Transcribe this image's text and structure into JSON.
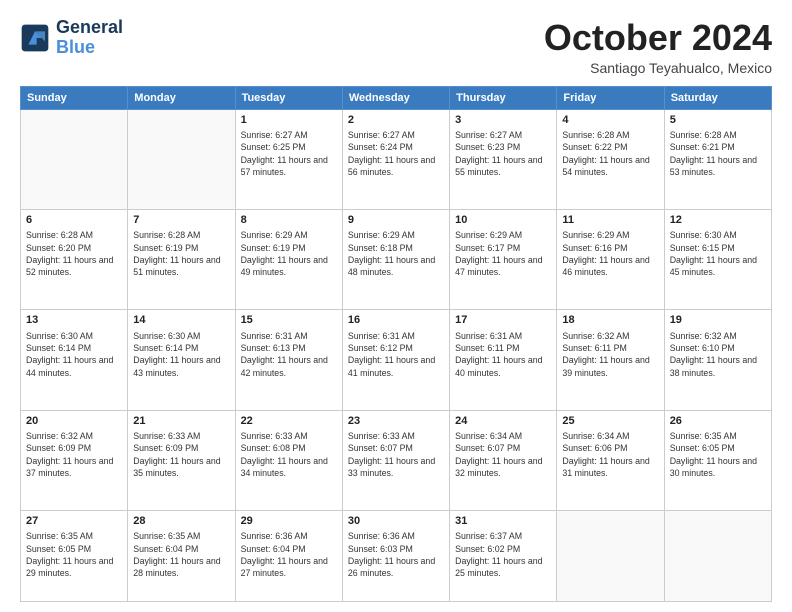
{
  "header": {
    "logo_line1": "General",
    "logo_line2": "Blue",
    "month_title": "October 2024",
    "subtitle": "Santiago Teyahualco, Mexico"
  },
  "days_of_week": [
    "Sunday",
    "Monday",
    "Tuesday",
    "Wednesday",
    "Thursday",
    "Friday",
    "Saturday"
  ],
  "weeks": [
    [
      {
        "day": "",
        "info": ""
      },
      {
        "day": "",
        "info": ""
      },
      {
        "day": "1",
        "info": "Sunrise: 6:27 AM\nSunset: 6:25 PM\nDaylight: 11 hours and 57 minutes."
      },
      {
        "day": "2",
        "info": "Sunrise: 6:27 AM\nSunset: 6:24 PM\nDaylight: 11 hours and 56 minutes."
      },
      {
        "day": "3",
        "info": "Sunrise: 6:27 AM\nSunset: 6:23 PM\nDaylight: 11 hours and 55 minutes."
      },
      {
        "day": "4",
        "info": "Sunrise: 6:28 AM\nSunset: 6:22 PM\nDaylight: 11 hours and 54 minutes."
      },
      {
        "day": "5",
        "info": "Sunrise: 6:28 AM\nSunset: 6:21 PM\nDaylight: 11 hours and 53 minutes."
      }
    ],
    [
      {
        "day": "6",
        "info": "Sunrise: 6:28 AM\nSunset: 6:20 PM\nDaylight: 11 hours and 52 minutes."
      },
      {
        "day": "7",
        "info": "Sunrise: 6:28 AM\nSunset: 6:19 PM\nDaylight: 11 hours and 51 minutes."
      },
      {
        "day": "8",
        "info": "Sunrise: 6:29 AM\nSunset: 6:19 PM\nDaylight: 11 hours and 49 minutes."
      },
      {
        "day": "9",
        "info": "Sunrise: 6:29 AM\nSunset: 6:18 PM\nDaylight: 11 hours and 48 minutes."
      },
      {
        "day": "10",
        "info": "Sunrise: 6:29 AM\nSunset: 6:17 PM\nDaylight: 11 hours and 47 minutes."
      },
      {
        "day": "11",
        "info": "Sunrise: 6:29 AM\nSunset: 6:16 PM\nDaylight: 11 hours and 46 minutes."
      },
      {
        "day": "12",
        "info": "Sunrise: 6:30 AM\nSunset: 6:15 PM\nDaylight: 11 hours and 45 minutes."
      }
    ],
    [
      {
        "day": "13",
        "info": "Sunrise: 6:30 AM\nSunset: 6:14 PM\nDaylight: 11 hours and 44 minutes."
      },
      {
        "day": "14",
        "info": "Sunrise: 6:30 AM\nSunset: 6:14 PM\nDaylight: 11 hours and 43 minutes."
      },
      {
        "day": "15",
        "info": "Sunrise: 6:31 AM\nSunset: 6:13 PM\nDaylight: 11 hours and 42 minutes."
      },
      {
        "day": "16",
        "info": "Sunrise: 6:31 AM\nSunset: 6:12 PM\nDaylight: 11 hours and 41 minutes."
      },
      {
        "day": "17",
        "info": "Sunrise: 6:31 AM\nSunset: 6:11 PM\nDaylight: 11 hours and 40 minutes."
      },
      {
        "day": "18",
        "info": "Sunrise: 6:32 AM\nSunset: 6:11 PM\nDaylight: 11 hours and 39 minutes."
      },
      {
        "day": "19",
        "info": "Sunrise: 6:32 AM\nSunset: 6:10 PM\nDaylight: 11 hours and 38 minutes."
      }
    ],
    [
      {
        "day": "20",
        "info": "Sunrise: 6:32 AM\nSunset: 6:09 PM\nDaylight: 11 hours and 37 minutes."
      },
      {
        "day": "21",
        "info": "Sunrise: 6:33 AM\nSunset: 6:09 PM\nDaylight: 11 hours and 35 minutes."
      },
      {
        "day": "22",
        "info": "Sunrise: 6:33 AM\nSunset: 6:08 PM\nDaylight: 11 hours and 34 minutes."
      },
      {
        "day": "23",
        "info": "Sunrise: 6:33 AM\nSunset: 6:07 PM\nDaylight: 11 hours and 33 minutes."
      },
      {
        "day": "24",
        "info": "Sunrise: 6:34 AM\nSunset: 6:07 PM\nDaylight: 11 hours and 32 minutes."
      },
      {
        "day": "25",
        "info": "Sunrise: 6:34 AM\nSunset: 6:06 PM\nDaylight: 11 hours and 31 minutes."
      },
      {
        "day": "26",
        "info": "Sunrise: 6:35 AM\nSunset: 6:05 PM\nDaylight: 11 hours and 30 minutes."
      }
    ],
    [
      {
        "day": "27",
        "info": "Sunrise: 6:35 AM\nSunset: 6:05 PM\nDaylight: 11 hours and 29 minutes."
      },
      {
        "day": "28",
        "info": "Sunrise: 6:35 AM\nSunset: 6:04 PM\nDaylight: 11 hours and 28 minutes."
      },
      {
        "day": "29",
        "info": "Sunrise: 6:36 AM\nSunset: 6:04 PM\nDaylight: 11 hours and 27 minutes."
      },
      {
        "day": "30",
        "info": "Sunrise: 6:36 AM\nSunset: 6:03 PM\nDaylight: 11 hours and 26 minutes."
      },
      {
        "day": "31",
        "info": "Sunrise: 6:37 AM\nSunset: 6:02 PM\nDaylight: 11 hours and 25 minutes."
      },
      {
        "day": "",
        "info": ""
      },
      {
        "day": "",
        "info": ""
      }
    ]
  ]
}
